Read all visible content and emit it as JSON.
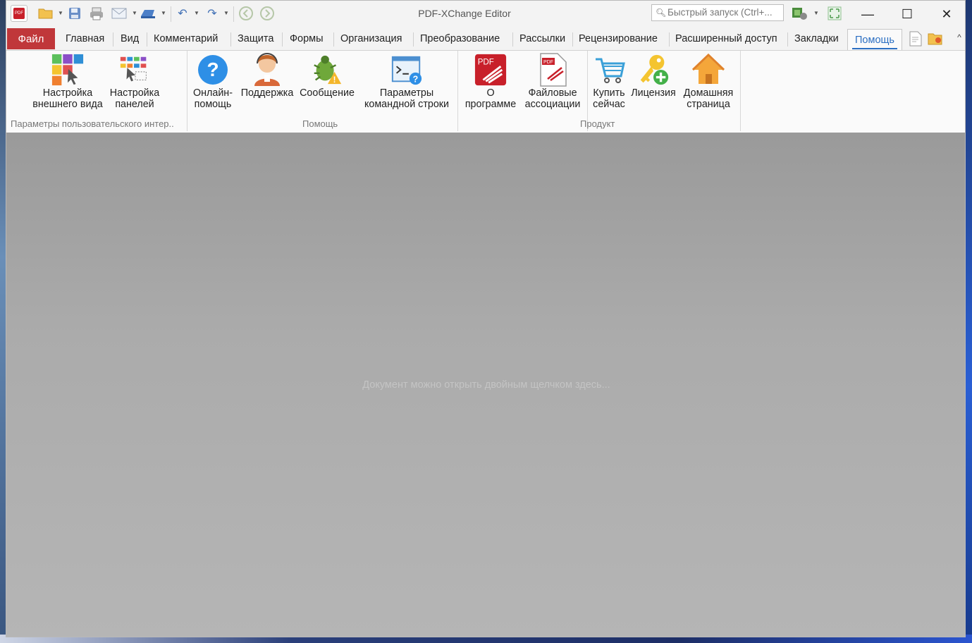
{
  "window": {
    "title": "PDF-XChange Editor",
    "search_placeholder": "Быстрый запуск (Ctrl+..."
  },
  "tabs": {
    "file": "Файл",
    "items": [
      "Главная",
      "Вид",
      "Комментарий",
      "Защита",
      "Формы",
      "Организация",
      "Преобразование",
      "Рассылки",
      "Рецензирование",
      "Расширенный доступ",
      "Закладки"
    ],
    "active": "Помощь"
  },
  "ribbon": {
    "groups": [
      {
        "label": "Параметры пользовательского интер..",
        "buttons": [
          "Настройка\nвнешнего вида",
          "Настройка\nпанелей"
        ]
      },
      {
        "label": "Помощь",
        "buttons": [
          "Онлайн-\nпомощь",
          "Поддержка",
          "Сообщение",
          "Параметры\nкомандной строки"
        ]
      },
      {
        "label": "Продукт",
        "buttons": [
          "О\nпрограмме",
          "Файловые\nассоциации",
          "Купить\nсейчас",
          "Лицензия",
          "Домашняя\nстраница"
        ]
      }
    ]
  },
  "document": {
    "empty_message": "Документ можно открыть двойным щелчком здесь..."
  },
  "colors": {
    "file_tab": "#c0373a",
    "active_tab_text": "#2c6fc2"
  }
}
